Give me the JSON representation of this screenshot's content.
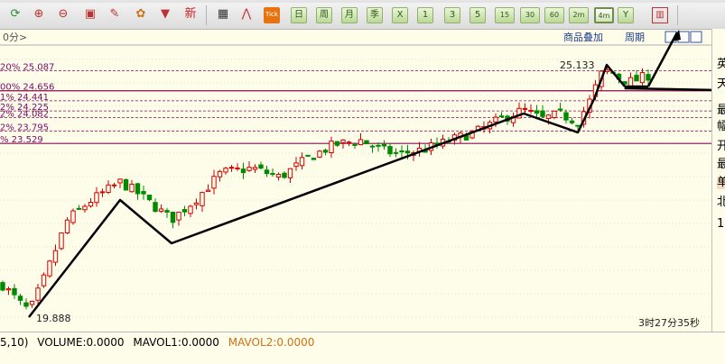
{
  "toolbar": {
    "buttons": [
      {
        "name": "refresh-icon",
        "glyph": "⟳",
        "color": "#2c8c2c"
      },
      {
        "name": "zoom-in-icon",
        "glyph": "⊕",
        "color": "#c03030"
      },
      {
        "name": "zoom-out-icon",
        "glyph": "⊖",
        "color": "#c03030"
      },
      {
        "name": "window-icon",
        "glyph": "▣",
        "color": "#c03030"
      },
      {
        "name": "draw-pen-icon",
        "glyph": "✎",
        "color": "#c03030"
      },
      {
        "name": "palette-icon",
        "glyph": "✿",
        "color": "#d07018"
      },
      {
        "name": "filter-icon",
        "glyph": "▼",
        "color": "#c03030"
      },
      {
        "name": "new-icon",
        "glyph": "新",
        "color": "#d02020"
      },
      {
        "name": "table-icon",
        "glyph": "▦",
        "color": "#333333"
      },
      {
        "name": "trend-icon",
        "glyph": "⋀",
        "color": "#c03030"
      }
    ],
    "tick_label": "Tick",
    "periods": [
      "日",
      "周",
      "月",
      "季",
      "X",
      "1",
      "3",
      "5",
      "15",
      "30",
      "60",
      "2m",
      "4m",
      "Y"
    ],
    "selected_period": "4m",
    "last_icon": "▥"
  },
  "chart": {
    "period_label": "0分>",
    "overlay_label": "商品叠加",
    "cycle_label": "周期",
    "colors": {
      "up": "#d40000",
      "down": "#008a00",
      "arrow": "#000000",
      "fib": "#8b0a52",
      "price_text": "#222222",
      "label_purple": "#7a0a6e"
    },
    "fib_levels": [
      {
        "price": 25.087,
        "label": "20% 25.087"
      },
      {
        "price": 24.656,
        "label": "00% 24.656"
      },
      {
        "price": 24.441,
        "label": "1% 24.441"
      },
      {
        "price": 24.225,
        "label": "2% 24.225"
      },
      {
        "price": 24.082,
        "label": "2% 24.082"
      },
      {
        "price": 23.795,
        "label": "2% 23.795"
      },
      {
        "price": 23.529,
        "label": "% 23.529"
      }
    ],
    "high_label": "25.133",
    "low_label": "19.888",
    "time_label": "3时27分35秒"
  },
  "indicator": {
    "volume_label": "VOLUME:0.0000",
    "mavol1_label": "MAVOL1:0.0000",
    "mavol2_label": "MAVOL2:0.0000",
    "params": "5,10)"
  },
  "right_panel": [
    "英",
    "天",
    "最",
    "幅",
    "开",
    "最",
    "单",
    "北",
    "1"
  ]
}
